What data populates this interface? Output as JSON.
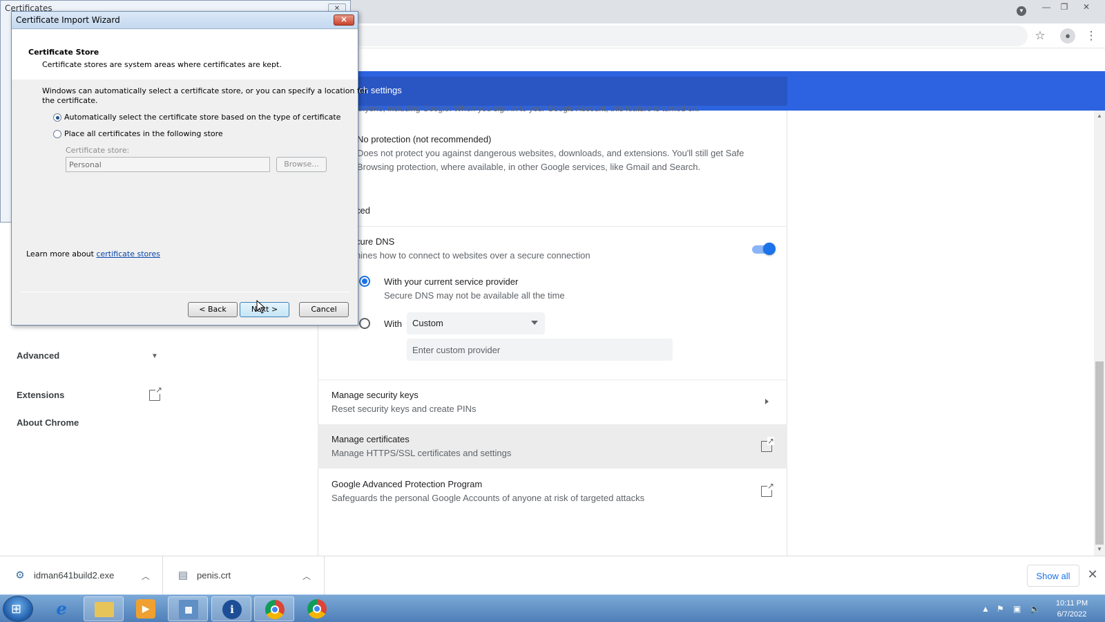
{
  "browser": {
    "window_controls": [
      "—",
      "❐",
      "✕"
    ],
    "profile_dropdown_icon": "chevron-down-icon",
    "toolbar_icons": [
      "star-icon",
      "account-icon",
      "more-icon"
    ]
  },
  "settings": {
    "search_placeholder": "arch settings",
    "nav": {
      "advanced_label": "Advanced",
      "extensions_label": "Extensions",
      "about_label": "About Chrome"
    },
    "clipped_top_text": "anyone, including Google. When you sign in to your Google Account, this feature is turned on.",
    "no_protection": {
      "title": "No protection (not recommended)",
      "desc_line1": "Does not protect you against dangerous websites, downloads, and extensions. You'll still get Safe",
      "desc_line2": "Browsing protection, where available, in other Google services, like Gmail and Search."
    },
    "advanced_heading": "ced",
    "secure_dns": {
      "title": "cure DNS",
      "desc": "nines how to connect to websites over a secure connection",
      "enabled": true,
      "option_current": "With your current service provider",
      "option_current_desc": "Secure DNS may not be available all the time",
      "option_with": "With",
      "provider_value": "Custom",
      "custom_placeholder": "Enter custom provider"
    },
    "security_keys": {
      "title": "Manage security keys",
      "desc": "Reset security keys and create PINs"
    },
    "certificates": {
      "title": "Manage certificates",
      "desc": "Manage HTTPS/SSL certificates and settings"
    },
    "advanced_protection": {
      "title": "Google Advanced Protection Program",
      "desc": "Safeguards the personal Google Accounts of anyone at risk of targeted attacks"
    }
  },
  "downloads": {
    "items": [
      {
        "name": "idman641build2.exe",
        "icon": "installer-icon"
      },
      {
        "name": "penis.crt",
        "icon": "certificate-file-icon"
      }
    ],
    "show_all_label": "Show all"
  },
  "cert_window": {
    "title": "Certificates"
  },
  "wizard": {
    "title": "Certificate Import Wizard",
    "heading": "Certificate Store",
    "subheading": "Certificate stores are system areas where certificates are kept.",
    "intro_line1": "Windows can automatically select a certificate store, or you can specify a location for",
    "intro_line2": "the certificate.",
    "option_auto": "Automatically select the certificate store based on the type of certificate",
    "option_manual": "Place all certificates in the following store",
    "selected_option": "auto",
    "store_label": "Certificate store:",
    "store_value": "Personal",
    "browse_label": "Browse...",
    "learn_prefix": "Learn more about ",
    "learn_link": "certificate stores",
    "back_label": "< Back",
    "next_label": "Next >",
    "cancel_label": "Cancel"
  },
  "taskbar": {
    "apps": [
      "windows-start-icon",
      "internet-explorer-icon",
      "file-explorer-icon",
      "media-player-icon",
      "control-panel-icon",
      "info-icon",
      "chrome-icon",
      "chrome-icon"
    ],
    "time": "10:11 PM",
    "date": "6/7/2022"
  }
}
